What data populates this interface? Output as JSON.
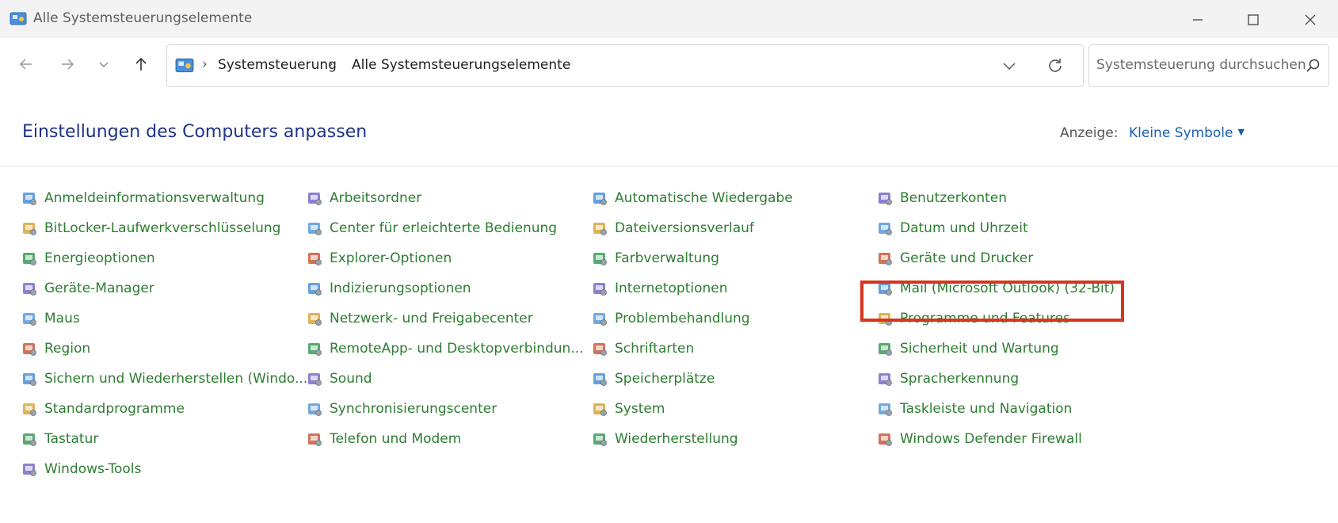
{
  "window": {
    "title": "Alle Systemsteuerungselemente"
  },
  "address": {
    "crumbs": [
      "Systemsteuerung",
      "Alle Systemsteuerungselemente"
    ]
  },
  "search": {
    "placeholder": "Systemsteuerung durchsuchen"
  },
  "header": {
    "title": "Einstellungen des Computers anpassen",
    "view_label": "Anzeige:",
    "view_value": "Kleine Symbole"
  },
  "columns": [
    [
      {
        "label": "Anmeldeinformationsverwaltung",
        "icon": "credential-icon"
      },
      {
        "label": "BitLocker-Laufwerkverschlüsselung",
        "icon": "bitlocker-icon"
      },
      {
        "label": "Energieoptionen",
        "icon": "power-icon"
      },
      {
        "label": "Geräte-Manager",
        "icon": "device-manager-icon"
      },
      {
        "label": "Maus",
        "icon": "mouse-icon"
      },
      {
        "label": "Region",
        "icon": "region-icon"
      },
      {
        "label": "Sichern und Wiederherstellen (Windo...",
        "icon": "backup-icon"
      },
      {
        "label": "Standardprogramme",
        "icon": "default-programs-icon"
      },
      {
        "label": "Tastatur",
        "icon": "keyboard-icon"
      },
      {
        "label": "Windows-Tools",
        "icon": "windows-tools-icon"
      }
    ],
    [
      {
        "label": "Arbeitsordner",
        "icon": "work-folders-icon"
      },
      {
        "label": "Center für erleichterte Bedienung",
        "icon": "ease-of-access-icon"
      },
      {
        "label": "Explorer-Optionen",
        "icon": "explorer-options-icon"
      },
      {
        "label": "Indizierungsoptionen",
        "icon": "indexing-icon"
      },
      {
        "label": "Netzwerk- und Freigabecenter",
        "icon": "network-icon"
      },
      {
        "label": "RemoteApp- und Desktopverbindun...",
        "icon": "remoteapp-icon"
      },
      {
        "label": "Sound",
        "icon": "sound-icon"
      },
      {
        "label": "Synchronisierungscenter",
        "icon": "sync-icon"
      },
      {
        "label": "Telefon und Modem",
        "icon": "phone-modem-icon"
      }
    ],
    [
      {
        "label": "Automatische Wiedergabe",
        "icon": "autoplay-icon"
      },
      {
        "label": "Dateiversionsverlauf",
        "icon": "file-history-icon"
      },
      {
        "label": "Farbverwaltung",
        "icon": "color-management-icon"
      },
      {
        "label": "Internetoptionen",
        "icon": "internet-options-icon"
      },
      {
        "label": "Problembehandlung",
        "icon": "troubleshooting-icon"
      },
      {
        "label": "Schriftarten",
        "icon": "fonts-icon"
      },
      {
        "label": "Speicherplätze",
        "icon": "storage-spaces-icon"
      },
      {
        "label": "System",
        "icon": "system-icon"
      },
      {
        "label": "Wiederherstellung",
        "icon": "recovery-icon"
      }
    ],
    [
      {
        "label": "Benutzerkonten",
        "icon": "user-accounts-icon"
      },
      {
        "label": "Datum und Uhrzeit",
        "icon": "date-time-icon"
      },
      {
        "label": "Geräte und Drucker",
        "icon": "devices-printers-icon"
      },
      {
        "label": "Mail (Microsoft Outlook) (32-Bit)",
        "icon": "mail-icon"
      },
      {
        "label": "Programme und Features",
        "icon": "programs-features-icon"
      },
      {
        "label": "Sicherheit und Wartung",
        "icon": "security-maintenance-icon"
      },
      {
        "label": "Spracherkennung",
        "icon": "speech-recognition-icon"
      },
      {
        "label": "Taskleiste und Navigation",
        "icon": "taskbar-icon"
      },
      {
        "label": "Windows Defender Firewall",
        "icon": "firewall-icon"
      }
    ]
  ],
  "colors": {
    "link": "#2e7d32",
    "title": "#1e3287",
    "highlight": "#d9341f"
  }
}
